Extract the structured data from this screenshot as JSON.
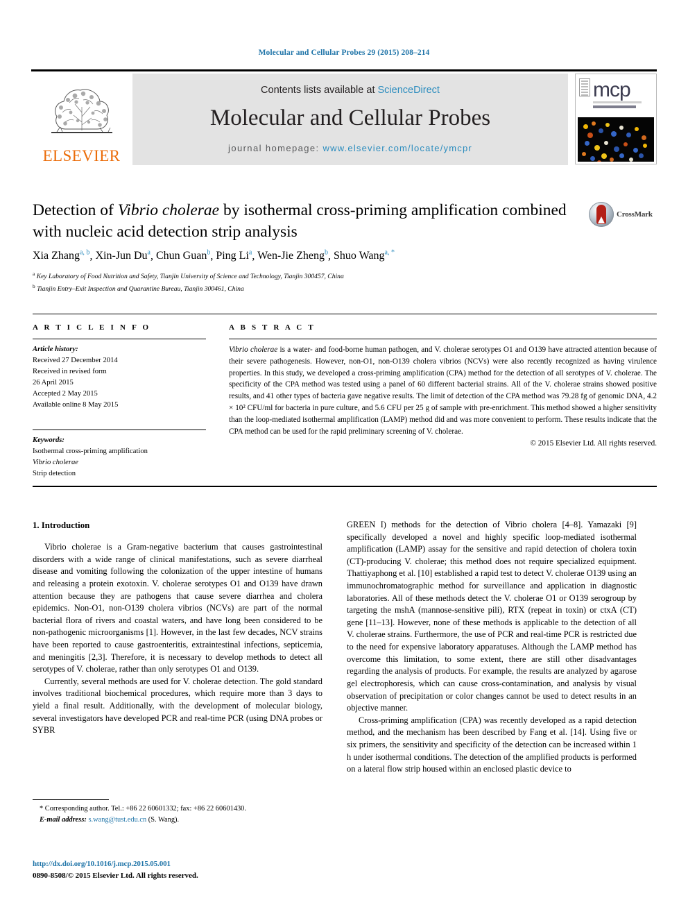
{
  "running_head": "Molecular and Cellular Probes 29 (2015) 208–214",
  "masthead": {
    "publisher_logo_text": "ELSEVIER",
    "contents_prefix": "Contents lists available at ",
    "contents_link": "ScienceDirect",
    "journal_title": "Molecular and Cellular Probes",
    "homepage_prefix": "journal homepage: ",
    "homepage_url": "www.elsevier.com/locate/ymcpr",
    "cover_logo_text": "mcp"
  },
  "article": {
    "title_line1_a": "Detection of ",
    "title_line1_italic": "Vibrio cholerae",
    "title_line1_b": " by isothermal cross-priming amplification",
    "title_line2": "combined with nucleic acid detection strip analysis",
    "crossmark_label": "CrossMark",
    "authors": [
      {
        "name": "Xia Zhang",
        "sup": "a, b"
      },
      {
        "name": "Xin-Jun Du",
        "sup": "a"
      },
      {
        "name": "Chun Guan",
        "sup": "b"
      },
      {
        "name": "Ping Li",
        "sup": "a"
      },
      {
        "name": "Wen-Jie Zheng",
        "sup": "b"
      },
      {
        "name": "Shuo Wang",
        "sup": "a, *"
      }
    ],
    "affiliations": [
      {
        "mark": "a",
        "text": "Key Laboratory of Food Nutrition and Safety, Tianjin University of Science and Technology, Tianjin 300457, China"
      },
      {
        "mark": "b",
        "text": "Tianjin Entry–Exit Inspection and Quarantine Bureau, Tianjin 300461, China"
      }
    ]
  },
  "article_info": {
    "heading": "A R T I C L E  I N F O",
    "history_label": "Article history:",
    "history": [
      "Received 27 December 2014",
      "Received in revised form",
      "26 April 2015",
      "Accepted 2 May 2015",
      "Available online 8 May 2015"
    ],
    "keywords_label": "Keywords:",
    "keywords": [
      "Isothermal cross-priming amplification",
      "Vibrio cholerae",
      "Strip detection"
    ]
  },
  "abstract": {
    "heading": "A B S T R A C T",
    "p1_italic_lead": "Vibrio cholerae",
    "p1_rest": " is a water- and food-borne human pathogen, and V. cholerae serotypes O1 and O139 have attracted attention because of their severe pathogenesis. However, non-O1, non-O139 cholera vibrios (NCVs) were also recently recognized as having virulence properties. In this study, we developed a cross-priming amplification (CPA) method for the detection of all serotypes of V. cholerae. The specificity of the CPA method was tested using a panel of 60 different bacterial strains. All of the V. cholerae strains showed positive results, and 41 other types of bacteria gave negative results. The limit of detection of the CPA method was 79.28 fg of genomic DNA, 4.2 × 10² CFU/ml for bacteria in pure culture, and 5.6 CFU per 25 g of sample with pre-enrichment. This method showed a higher sensitivity than the loop-mediated isothermal amplification (LAMP) method did and was more convenient to perform. These results indicate that the CPA method can be used for the rapid preliminary screening of V. cholerae.",
    "copyright": "© 2015 Elsevier Ltd. All rights reserved."
  },
  "introduction": {
    "heading": "1. Introduction",
    "left_paragraphs": [
      "Vibrio cholerae is a Gram-negative bacterium that causes gastrointestinal disorders with a wide range of clinical manifestations, such as severe diarrheal disease and vomiting following the colonization of the upper intestine of humans and releasing a protein exotoxin. V. cholerae serotypes O1 and O139 have drawn attention because they are pathogens that cause severe diarrhea and cholera epidemics. Non-O1, non-O139 cholera vibrios (NCVs) are part of the normal bacterial flora of rivers and coastal waters, and have long been considered to be non-pathogenic microorganisms [1]. However, in the last few decades, NCV strains have been reported to cause gastroenteritis, extraintestinal infections, septicemia, and meningitis [2,3]. Therefore, it is necessary to develop methods to detect all serotypes of V. cholerae, rather than only serotypes O1 and O139.",
      "Currently, several methods are used for V. cholerae detection. The gold standard involves traditional biochemical procedures, which require more than 3 days to yield a final result. Additionally, with the development of molecular biology, several investigators have developed PCR and real-time PCR (using DNA probes or SYBR"
    ],
    "right_paragraphs": [
      "GREEN I) methods for the detection of Vibrio cholera [4–8]. Yamazaki [9] specifically developed a novel and highly specific loop-mediated isothermal amplification (LAMP) assay for the sensitive and rapid detection of cholera toxin (CT)-producing V. cholerae; this method does not require specialized equipment. Thattiyaphong et al. [10] established a rapid test to detect V. cholerae O139 using an immunochromatographic method for surveillance and application in diagnostic laboratories. All of these methods detect the V. cholerae O1 or O139 serogroup by targeting the mshA (mannose-sensitive pili), RTX (repeat in toxin) or ctxA (CT) gene [11–13]. However, none of these methods is applicable to the detection of all V. cholerae strains. Furthermore, the use of PCR and real-time PCR is restricted due to the need for expensive laboratory apparatuses. Although the LAMP method has overcome this limitation, to some extent, there are still other disadvantages regarding the analysis of products. For example, the results are analyzed by agarose gel electrophoresis, which can cause cross-contamination, and analysis by visual observation of precipitation or color changes cannot be used to detect results in an objective manner.",
      "Cross-priming amplification (CPA) was recently developed as a rapid detection method, and the mechanism has been described by Fang et al. [14]. Using five or six primers, the sensitivity and specificity of the detection can be increased within 1 h under isothermal conditions. The detection of the amplified products is performed on a lateral flow strip housed within an enclosed plastic device to"
    ]
  },
  "footnote": {
    "corresponding": "* Corresponding author. Tel.: +86 22 60601332; fax: +86 22 60601430.",
    "email_label": "E-mail address:",
    "email": "s.wang@tust.edu.cn",
    "email_suffix": " (S. Wang)."
  },
  "footer": {
    "doi": "http://dx.doi.org/10.1016/j.mcp.2015.05.001",
    "issn": "0890-8508/© 2015 Elsevier Ltd. All rights reserved."
  },
  "colors": {
    "link": "#1f74a8",
    "sciencedirect": "#2b8cbe",
    "elsevier_orange": "#eb6c09",
    "band_gray": "#e3e3e3"
  }
}
